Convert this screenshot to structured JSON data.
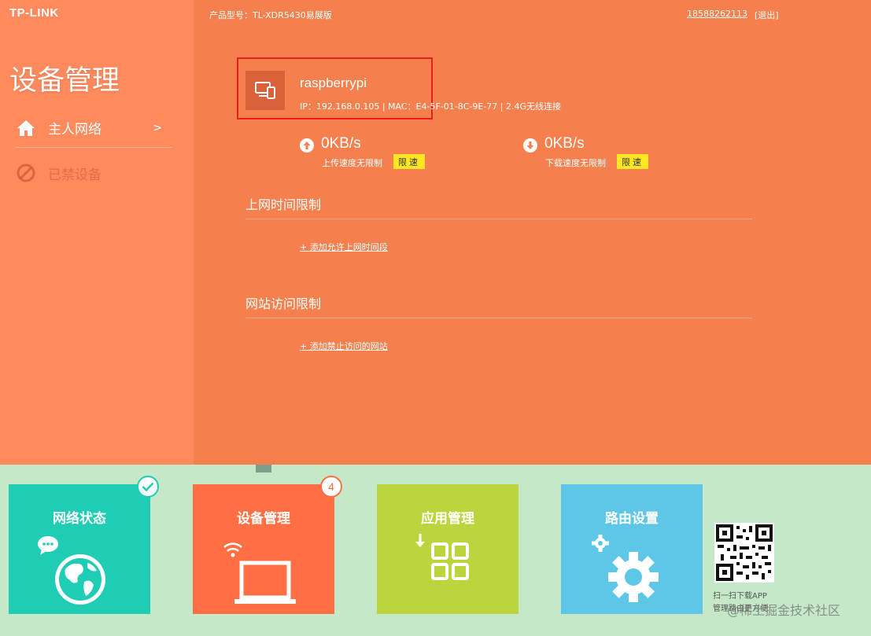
{
  "header": {
    "logo": "TP-LINK",
    "product_model": "产品型号：TL-XDR5430易展版",
    "account": "18588262113",
    "logout": "[退出]"
  },
  "sidebar": {
    "title": "设备管理",
    "items": [
      {
        "label": "主人网络",
        "icon": "home-icon",
        "chevron": ">"
      },
      {
        "label": "已禁设备",
        "icon": "forbidden-icon"
      }
    ]
  },
  "device": {
    "name": "raspberrypi",
    "info": "IP：192.168.0.105 | MAC：E4-5F-01-8C-9E-77 | 2.4G无线连接",
    "icon": "devices-icon"
  },
  "upload": {
    "value": "0KB/s",
    "desc": "上传速度无限制",
    "limit_label": "限速",
    "icon": "upload-arrow-icon"
  },
  "download": {
    "value": "0KB/s",
    "desc": "下载速度无限制",
    "limit_label": "限速",
    "icon": "download-arrow-icon"
  },
  "time_limit": {
    "title": "上网时间限制",
    "add_label": "+ 添加允许上网时间段"
  },
  "web_limit": {
    "title": "网站访问限制",
    "add_label": "+ 添加禁止访问的网站"
  },
  "tiles": [
    {
      "label": "网络状态",
      "color": "#1fcdb4"
    },
    {
      "label": "设备管理",
      "color": "#fe7043",
      "badge": "4"
    },
    {
      "label": "应用管理",
      "color": "#bcd53c"
    },
    {
      "label": "路由设置",
      "color": "#5ec7e7"
    }
  ],
  "qr": {
    "line1": "扫一扫下载APP",
    "line2": "管理路由更方便"
  },
  "watermark": "@稀土掘金技术社区",
  "colors": {
    "main_bg": "#f5804e",
    "sidebar_bg": "#ff8a5d",
    "bottom_bg": "#c4e8c8",
    "highlight_border": "#e8211c",
    "limit_button": "#fde723"
  }
}
